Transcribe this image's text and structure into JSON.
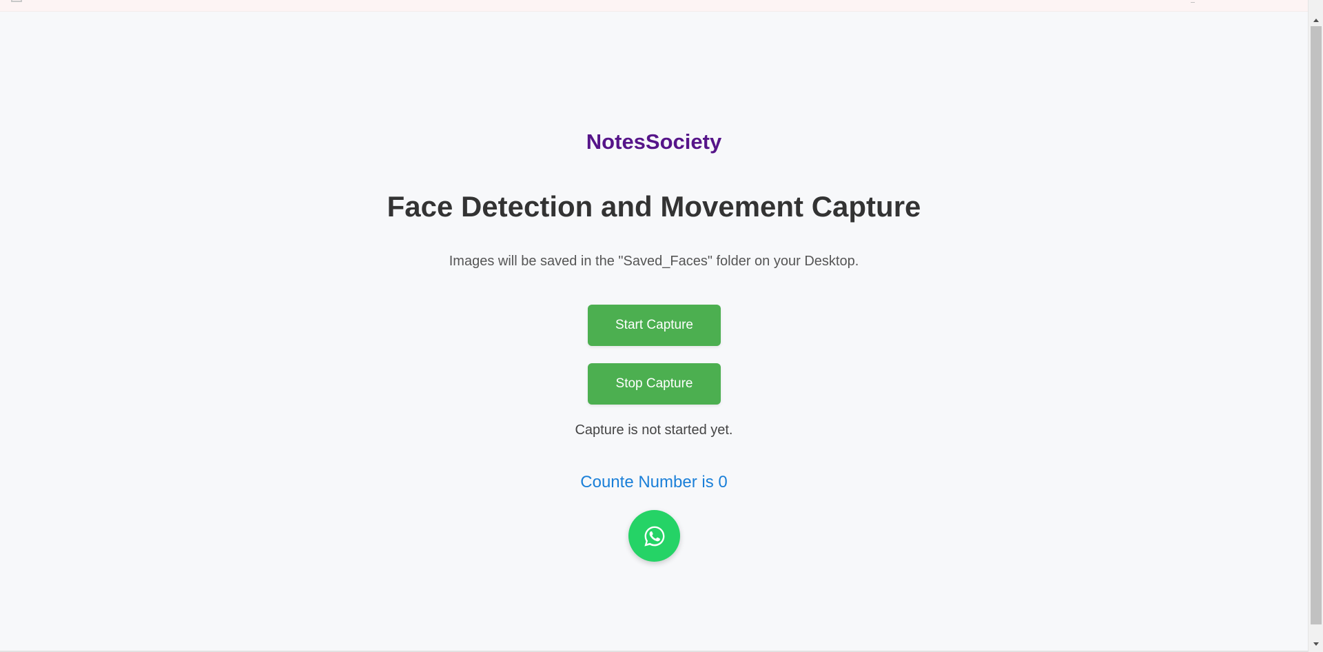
{
  "brand": {
    "name": "NotesSociety",
    "color": "#561589"
  },
  "main": {
    "title": "Face Detection and Movement Capture",
    "subtitle": "Images will be saved in the \"Saved_Faces\" folder on your Desktop.",
    "start_button_label": "Start Capture",
    "stop_button_label": "Stop Capture",
    "status_text": "Capture is not started yet.",
    "counter_text": "Counte Number is 0",
    "button_color": "#4caf50",
    "counter_color": "#1a7fd8"
  },
  "whatsapp": {
    "icon": "whatsapp-icon",
    "color": "#25d366"
  },
  "scrollbar": {
    "up_icon": "scroll-up-arrow-icon",
    "down_icon": "scroll-down-arrow-icon"
  }
}
